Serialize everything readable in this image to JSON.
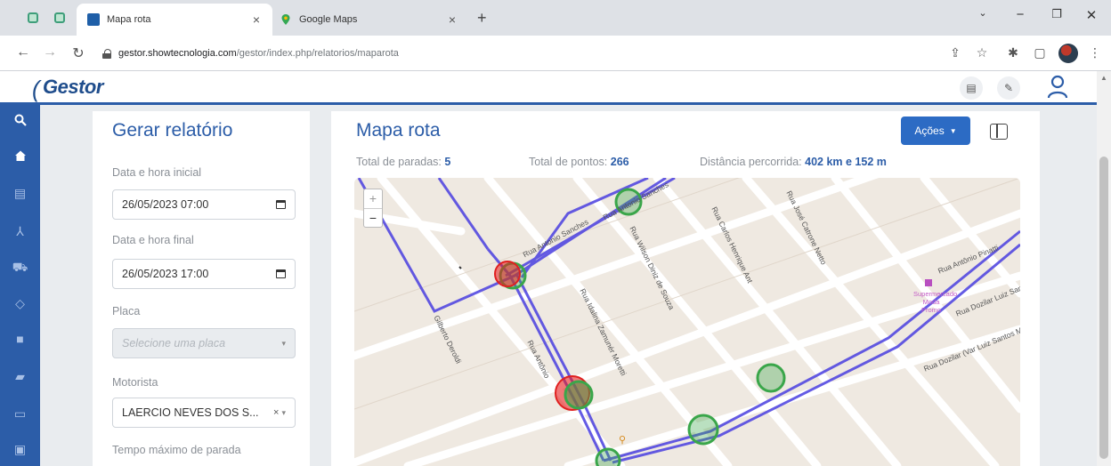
{
  "browser": {
    "tabs": [
      {
        "title": "Mapa rota",
        "active": true,
        "favicon_color": "#1f5fa8"
      },
      {
        "title": "Google Maps",
        "active": false,
        "favicon_color": "#34a853"
      }
    ],
    "url_host": "gestor.showtecnologia.com",
    "url_path": "/gestor/index.php/relatorios/maparota"
  },
  "app": {
    "logo": "Gestor",
    "brand_color": "#2c5da8"
  },
  "sidebar": {
    "items": [
      {
        "icon": "search-icon"
      },
      {
        "icon": "home-icon"
      },
      {
        "icon": "report-icon"
      },
      {
        "icon": "share-icon"
      },
      {
        "icon": "car-icon"
      },
      {
        "icon": "shield-icon"
      },
      {
        "icon": "chat-icon"
      },
      {
        "icon": "truck-icon"
      },
      {
        "icon": "folder-icon"
      },
      {
        "icon": "id-card-icon"
      }
    ]
  },
  "form": {
    "title": "Gerar relatório",
    "start_label": "Data e hora inicial",
    "start_value": "26/05/2023 07:00",
    "end_label": "Data e hora final",
    "end_value": "26/05/2023 17:00",
    "plate_label": "Placa",
    "plate_placeholder": "Selecione uma placa",
    "driver_label": "Motorista",
    "driver_value": "LAERCIO NEVES DOS S...",
    "max_stop_label": "Tempo máximo de parada"
  },
  "map_panel": {
    "title": "Mapa rota",
    "actions_label": "Ações",
    "stops_label": "Total de paradas:",
    "stops_value": "5",
    "points_label": "Total de pontos:",
    "points_value": "266",
    "distance_label": "Distância percorrida:",
    "distance_value": "402 km e 152 m",
    "zoom_in": "+",
    "zoom_out": "−",
    "streets": [
      "Rua Wilson Diniz de Souza",
      "Rua Carlos Henrique Ant",
      "Rua José Catrone Netto",
      "Rua Antônio Pinatti",
      "Rua Idalina Zamunér Moretti",
      "Rua Antônio",
      "Rua Dozilar (Var Luiz Santos Mi",
      "Rua Dozilar Luiz Santos Mar",
      "Gilberto Deroldi",
      "Rua Antonio Sanches",
      "Rua Antonio Sanches"
    ],
    "poi": "Supermercado Moda Promo",
    "route_color": "#4a3fe0",
    "stop_color": "#3aa64a"
  }
}
